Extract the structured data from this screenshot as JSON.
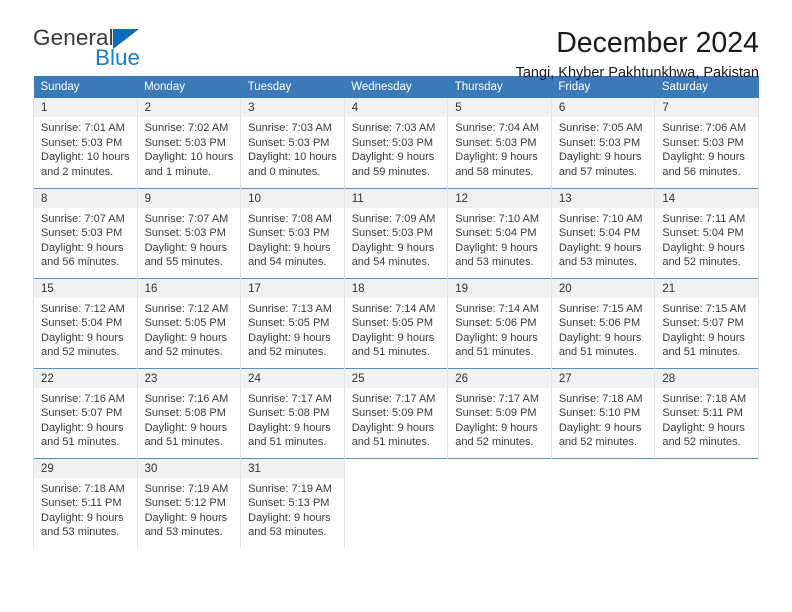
{
  "brand": {
    "name_part1": "General",
    "name_part2": "Blue",
    "accent_color": "#1a7fd4",
    "triangle_color": "#0a6cb4"
  },
  "header": {
    "title": "December 2024",
    "subtitle": "Tangi, Khyber Pakhtunkhwa, Pakistan"
  },
  "calendar": {
    "header_bg": "#3b79b8",
    "weekdays": [
      "Sunday",
      "Monday",
      "Tuesday",
      "Wednesday",
      "Thursday",
      "Friday",
      "Saturday"
    ],
    "weeks": [
      [
        {
          "day": "1",
          "sunrise": "Sunrise: 7:01 AM",
          "sunset": "Sunset: 5:03 PM",
          "daylight": "Daylight: 10 hours and 2 minutes."
        },
        {
          "day": "2",
          "sunrise": "Sunrise: 7:02 AM",
          "sunset": "Sunset: 5:03 PM",
          "daylight": "Daylight: 10 hours and 1 minute."
        },
        {
          "day": "3",
          "sunrise": "Sunrise: 7:03 AM",
          "sunset": "Sunset: 5:03 PM",
          "daylight": "Daylight: 10 hours and 0 minutes."
        },
        {
          "day": "4",
          "sunrise": "Sunrise: 7:03 AM",
          "sunset": "Sunset: 5:03 PM",
          "daylight": "Daylight: 9 hours and 59 minutes."
        },
        {
          "day": "5",
          "sunrise": "Sunrise: 7:04 AM",
          "sunset": "Sunset: 5:03 PM",
          "daylight": "Daylight: 9 hours and 58 minutes."
        },
        {
          "day": "6",
          "sunrise": "Sunrise: 7:05 AM",
          "sunset": "Sunset: 5:03 PM",
          "daylight": "Daylight: 9 hours and 57 minutes."
        },
        {
          "day": "7",
          "sunrise": "Sunrise: 7:06 AM",
          "sunset": "Sunset: 5:03 PM",
          "daylight": "Daylight: 9 hours and 56 minutes."
        }
      ],
      [
        {
          "day": "8",
          "sunrise": "Sunrise: 7:07 AM",
          "sunset": "Sunset: 5:03 PM",
          "daylight": "Daylight: 9 hours and 56 minutes."
        },
        {
          "day": "9",
          "sunrise": "Sunrise: 7:07 AM",
          "sunset": "Sunset: 5:03 PM",
          "daylight": "Daylight: 9 hours and 55 minutes."
        },
        {
          "day": "10",
          "sunrise": "Sunrise: 7:08 AM",
          "sunset": "Sunset: 5:03 PM",
          "daylight": "Daylight: 9 hours and 54 minutes."
        },
        {
          "day": "11",
          "sunrise": "Sunrise: 7:09 AM",
          "sunset": "Sunset: 5:03 PM",
          "daylight": "Daylight: 9 hours and 54 minutes."
        },
        {
          "day": "12",
          "sunrise": "Sunrise: 7:10 AM",
          "sunset": "Sunset: 5:04 PM",
          "daylight": "Daylight: 9 hours and 53 minutes."
        },
        {
          "day": "13",
          "sunrise": "Sunrise: 7:10 AM",
          "sunset": "Sunset: 5:04 PM",
          "daylight": "Daylight: 9 hours and 53 minutes."
        },
        {
          "day": "14",
          "sunrise": "Sunrise: 7:11 AM",
          "sunset": "Sunset: 5:04 PM",
          "daylight": "Daylight: 9 hours and 52 minutes."
        }
      ],
      [
        {
          "day": "15",
          "sunrise": "Sunrise: 7:12 AM",
          "sunset": "Sunset: 5:04 PM",
          "daylight": "Daylight: 9 hours and 52 minutes."
        },
        {
          "day": "16",
          "sunrise": "Sunrise: 7:12 AM",
          "sunset": "Sunset: 5:05 PM",
          "daylight": "Daylight: 9 hours and 52 minutes."
        },
        {
          "day": "17",
          "sunrise": "Sunrise: 7:13 AM",
          "sunset": "Sunset: 5:05 PM",
          "daylight": "Daylight: 9 hours and 52 minutes."
        },
        {
          "day": "18",
          "sunrise": "Sunrise: 7:14 AM",
          "sunset": "Sunset: 5:05 PM",
          "daylight": "Daylight: 9 hours and 51 minutes."
        },
        {
          "day": "19",
          "sunrise": "Sunrise: 7:14 AM",
          "sunset": "Sunset: 5:06 PM",
          "daylight": "Daylight: 9 hours and 51 minutes."
        },
        {
          "day": "20",
          "sunrise": "Sunrise: 7:15 AM",
          "sunset": "Sunset: 5:06 PM",
          "daylight": "Daylight: 9 hours and 51 minutes."
        },
        {
          "day": "21",
          "sunrise": "Sunrise: 7:15 AM",
          "sunset": "Sunset: 5:07 PM",
          "daylight": "Daylight: 9 hours and 51 minutes."
        }
      ],
      [
        {
          "day": "22",
          "sunrise": "Sunrise: 7:16 AM",
          "sunset": "Sunset: 5:07 PM",
          "daylight": "Daylight: 9 hours and 51 minutes."
        },
        {
          "day": "23",
          "sunrise": "Sunrise: 7:16 AM",
          "sunset": "Sunset: 5:08 PM",
          "daylight": "Daylight: 9 hours and 51 minutes."
        },
        {
          "day": "24",
          "sunrise": "Sunrise: 7:17 AM",
          "sunset": "Sunset: 5:08 PM",
          "daylight": "Daylight: 9 hours and 51 minutes."
        },
        {
          "day": "25",
          "sunrise": "Sunrise: 7:17 AM",
          "sunset": "Sunset: 5:09 PM",
          "daylight": "Daylight: 9 hours and 51 minutes."
        },
        {
          "day": "26",
          "sunrise": "Sunrise: 7:17 AM",
          "sunset": "Sunset: 5:09 PM",
          "daylight": "Daylight: 9 hours and 52 minutes."
        },
        {
          "day": "27",
          "sunrise": "Sunrise: 7:18 AM",
          "sunset": "Sunset: 5:10 PM",
          "daylight": "Daylight: 9 hours and 52 minutes."
        },
        {
          "day": "28",
          "sunrise": "Sunrise: 7:18 AM",
          "sunset": "Sunset: 5:11 PM",
          "daylight": "Daylight: 9 hours and 52 minutes."
        }
      ],
      [
        {
          "day": "29",
          "sunrise": "Sunrise: 7:18 AM",
          "sunset": "Sunset: 5:11 PM",
          "daylight": "Daylight: 9 hours and 53 minutes."
        },
        {
          "day": "30",
          "sunrise": "Sunrise: 7:19 AM",
          "sunset": "Sunset: 5:12 PM",
          "daylight": "Daylight: 9 hours and 53 minutes."
        },
        {
          "day": "31",
          "sunrise": "Sunrise: 7:19 AM",
          "sunset": "Sunset: 5:13 PM",
          "daylight": "Daylight: 9 hours and 53 minutes."
        },
        null,
        null,
        null,
        null
      ]
    ]
  }
}
